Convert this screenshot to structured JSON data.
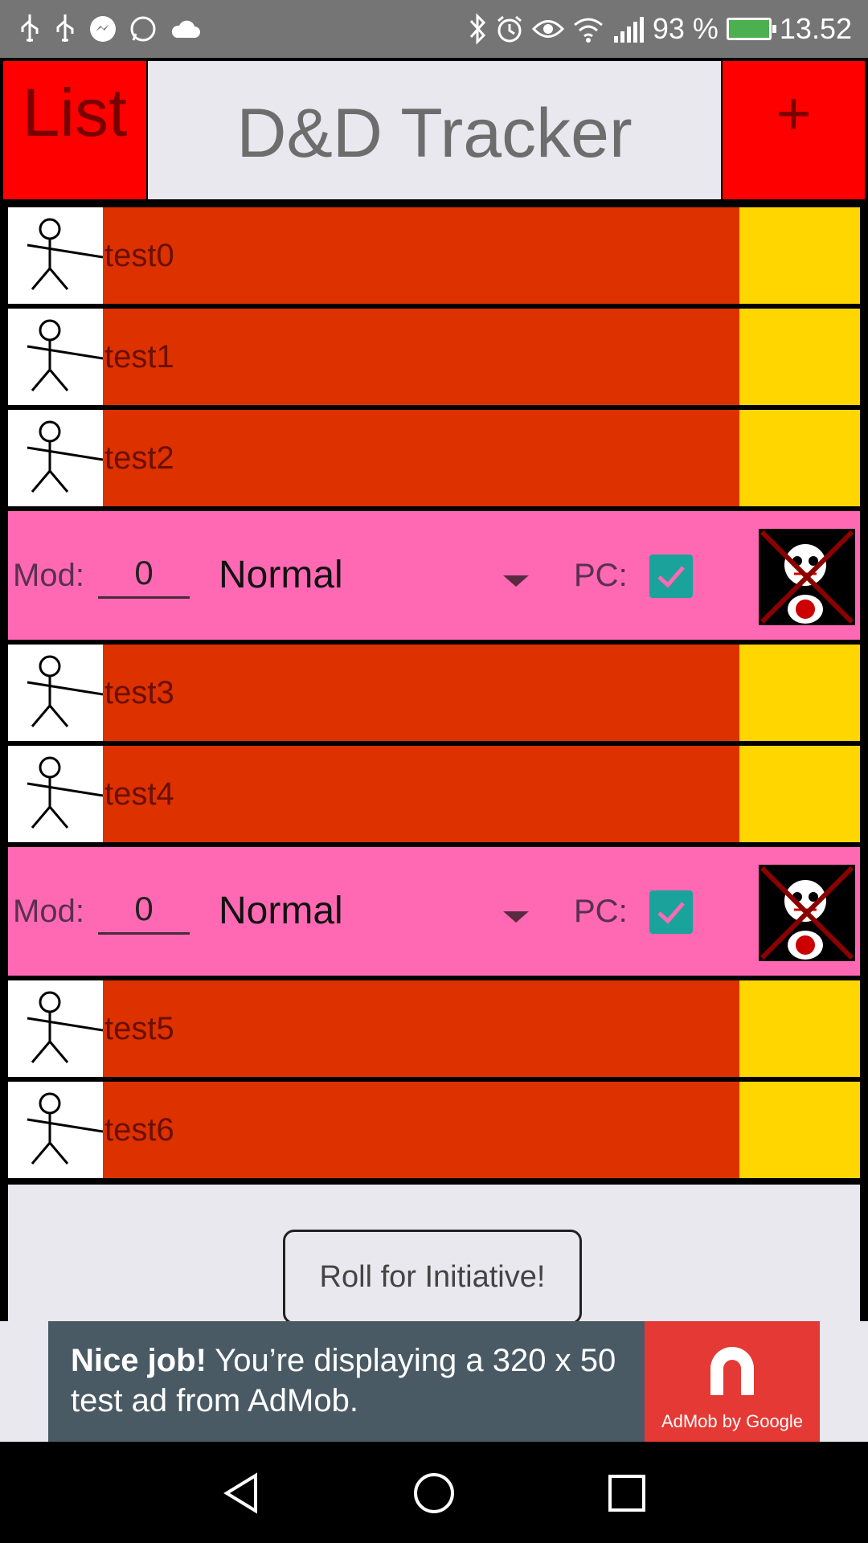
{
  "status_bar": {
    "battery": "93 %",
    "time": "13.52"
  },
  "header": {
    "list_label": "List",
    "title": "D&D Tracker",
    "add_label": "+"
  },
  "rows": [
    {
      "name": "test0"
    },
    {
      "name": "test1"
    },
    {
      "name": "test2"
    },
    {
      "name": "test3"
    },
    {
      "name": "test4"
    },
    {
      "name": "test5"
    },
    {
      "name": "test6"
    }
  ],
  "detail_panels": [
    {
      "mod_label": "Mod:",
      "mod_value": "0",
      "advantage": "Normal",
      "pc_label": "PC:",
      "pc_checked": true
    },
    {
      "mod_label": "Mod:",
      "mod_value": "0",
      "advantage": "Normal",
      "pc_label": "PC:",
      "pc_checked": true
    }
  ],
  "roll_button": "Roll for Initiative!",
  "ad": {
    "bold": "Nice job!",
    "text": " You’re displaying a 320 x 50 test ad from AdMob.",
    "logo_label": "AdMob by Google"
  },
  "colors": {
    "name_bar": "#dd3100",
    "initiative": "#ffd600",
    "detail": "#ff69b4",
    "header_red": "#ff0000"
  }
}
